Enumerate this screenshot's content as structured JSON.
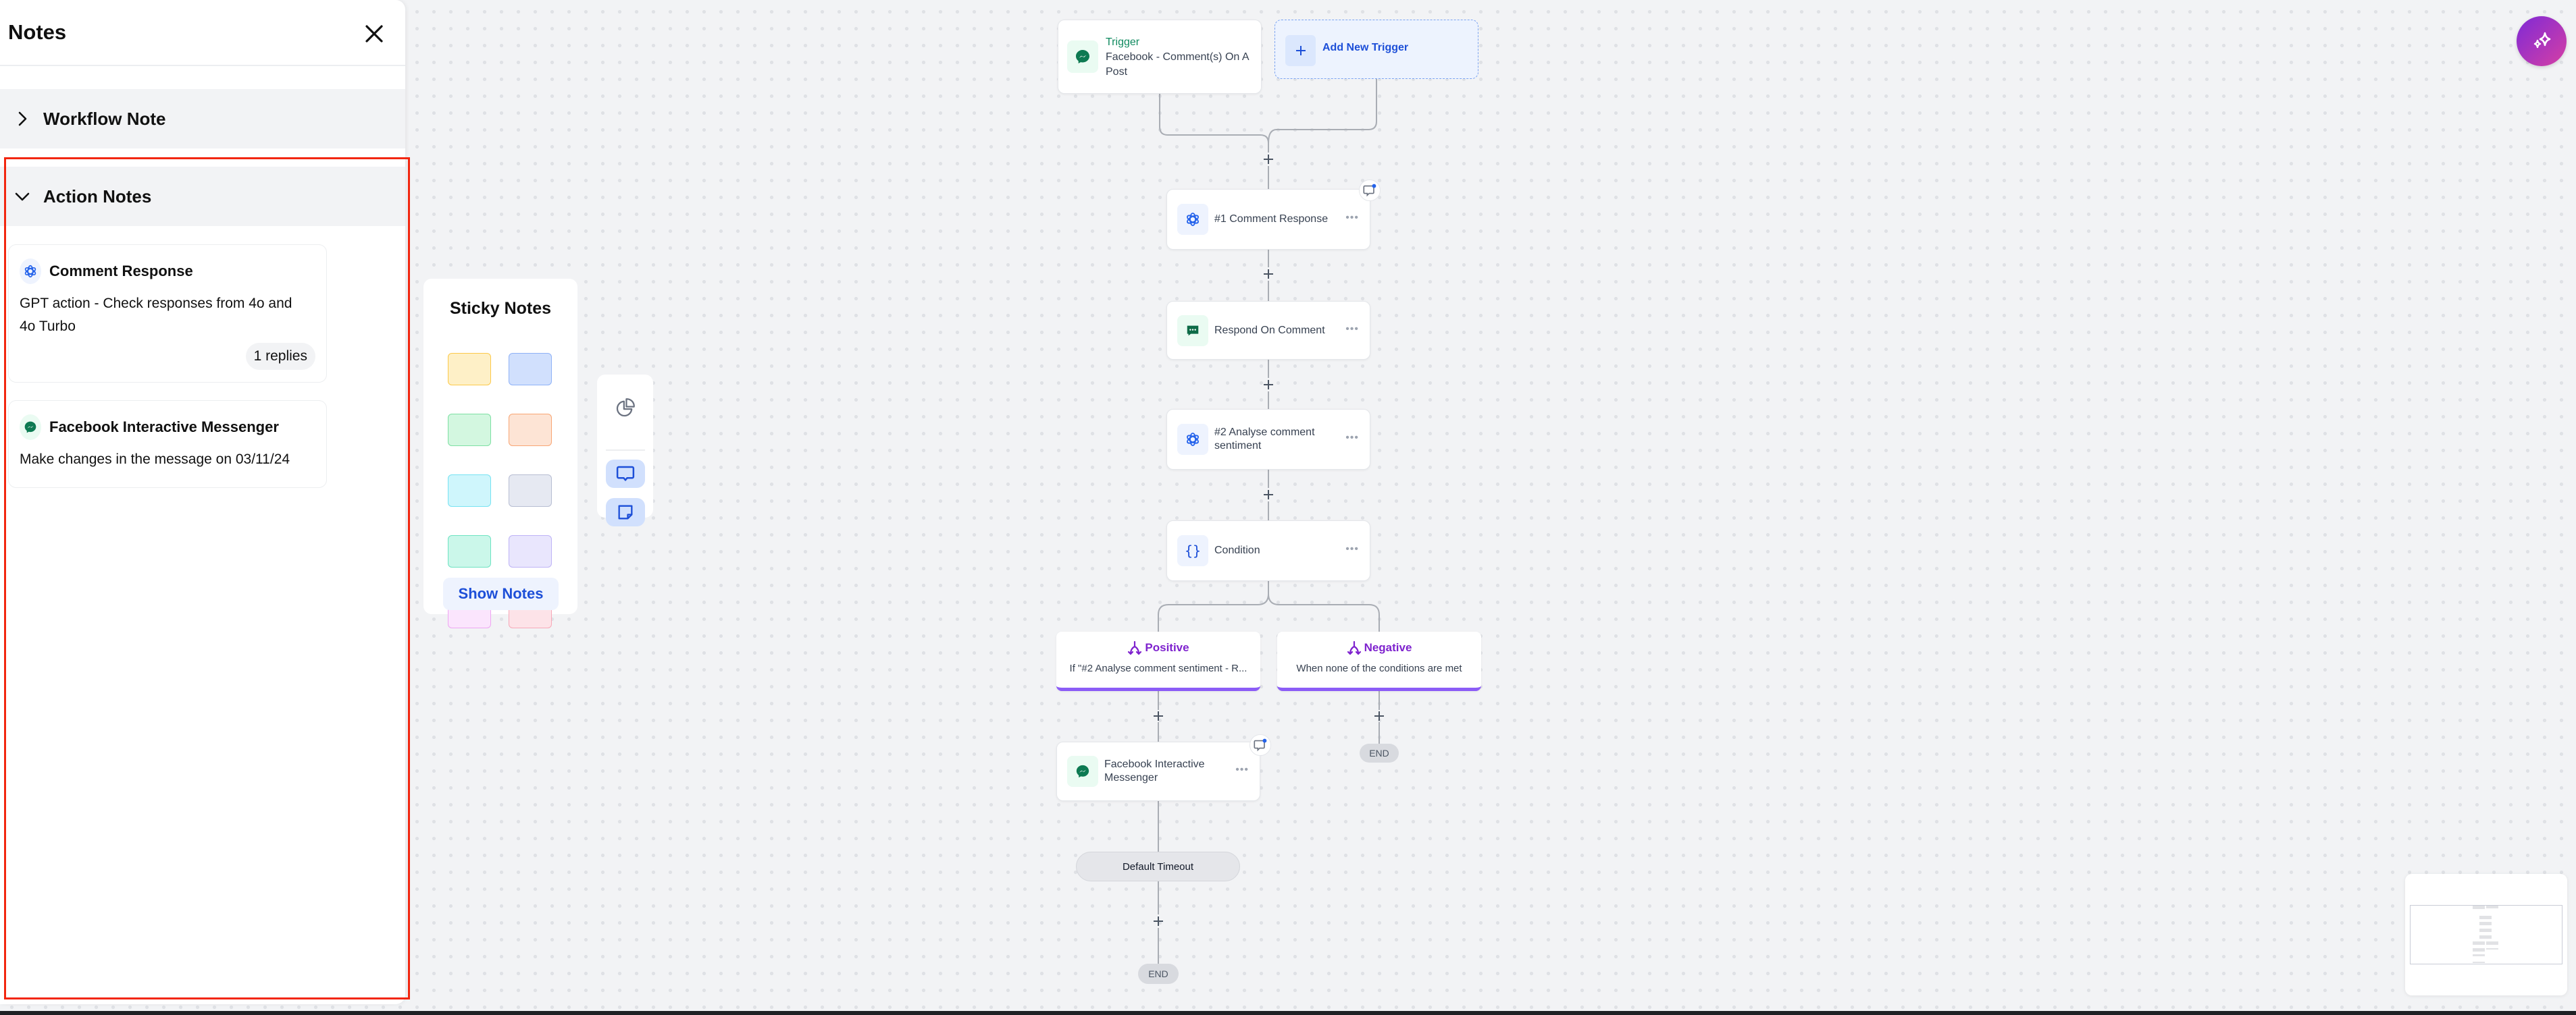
{
  "notes_panel": {
    "title": "Notes",
    "close_icon": "close-icon",
    "sections": [
      {
        "label": "Workflow Note",
        "expanded": false
      },
      {
        "label": "Action Notes",
        "expanded": true
      }
    ],
    "action_notes": [
      {
        "icon": "openai-icon",
        "title": "Comment Response",
        "body": "GPT action - Check responses from 4o and 4o Turbo",
        "replies": "1 replies"
      },
      {
        "icon": "messenger-icon",
        "title": "Facebook Interactive Messenger",
        "body": "Make changes in the message on 03/11/24"
      }
    ]
  },
  "sticky_notes": {
    "title": "Sticky Notes",
    "swatches": [
      {
        "name": "yellow",
        "fill": "#fef0c7",
        "border": "#fcc94a"
      },
      {
        "name": "blue",
        "fill": "#d1e0fd",
        "border": "#8fb2f7"
      },
      {
        "name": "green",
        "fill": "#d3f7e0",
        "border": "#7ee0a3"
      },
      {
        "name": "orange",
        "fill": "#fde4d5",
        "border": "#f8a574"
      },
      {
        "name": "cyan",
        "fill": "#cff6fc",
        "border": "#77e3f2"
      },
      {
        "name": "gray",
        "fill": "#e6e9f2",
        "border": "#b7bdd2"
      },
      {
        "name": "teal",
        "fill": "#cbf7ea",
        "border": "#6ee3c2"
      },
      {
        "name": "lavender",
        "fill": "#e9e6fd",
        "border": "#beb3f6"
      },
      {
        "name": "pink",
        "fill": "#fbe5fd",
        "border": "#eea6f2"
      },
      {
        "name": "rose",
        "fill": "#fde3e8",
        "border": "#f7a8b8"
      }
    ],
    "show_notes_label": "Show Notes"
  },
  "tools": [
    {
      "icon": "pie-chart-icon",
      "active": false
    },
    {
      "icon": "comment-icon",
      "active": true
    },
    {
      "icon": "sticky-note-icon",
      "active": true
    }
  ],
  "workflow": {
    "trigger": {
      "label": "Trigger",
      "name": "Facebook - Comment(s) On A Post",
      "icon": "messenger-icon"
    },
    "add_trigger": {
      "label": "Add New Trigger"
    },
    "actions": [
      {
        "name": "#1 Comment Response",
        "icon": "openai-icon",
        "has_comment": true
      },
      {
        "name": "Respond On Comment",
        "icon": "chat-bubble-icon",
        "has_comment": false
      },
      {
        "name": "#2 Analyse comment sentiment",
        "icon": "openai-icon",
        "has_comment": false
      },
      {
        "name": "Condition",
        "icon": "braces-icon",
        "has_comment": false
      }
    ],
    "branches": [
      {
        "label": "Positive",
        "description": "If \"#2 Analyse comment sentiment - R..."
      },
      {
        "label": "Negative",
        "description": "When none of the conditions are met"
      }
    ],
    "positive_action": {
      "name": "Facebook Interactive Messenger",
      "icon": "messenger-icon",
      "has_comment": true
    },
    "timeout_label": "Default Timeout",
    "end_label": "END",
    "more_label": "•••"
  },
  "colors": {
    "accent_blue": "#1d4fd8",
    "trigger_green": "#0f8a5f",
    "branch_purple": "#7e22ce",
    "highlight_red": "#f2260f"
  }
}
